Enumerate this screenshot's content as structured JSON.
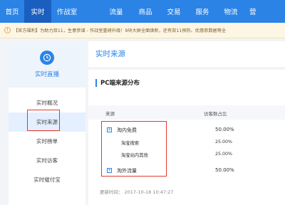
{
  "nav": {
    "items": [
      {
        "label": "首页",
        "active": false
      },
      {
        "label": "实时",
        "active": true
      },
      {
        "label": "作战室",
        "active": false
      },
      {
        "label": "流量",
        "active": false
      },
      {
        "label": "商品",
        "active": false
      },
      {
        "label": "交易",
        "active": false
      },
      {
        "label": "服务",
        "active": false
      },
      {
        "label": "物流",
        "active": false
      },
      {
        "label": "营",
        "active": false
      }
    ]
  },
  "notice": {
    "icon": "exclamation-icon",
    "text": "【官方福利】为助力双11，生意参谋 - 作战室重磅升级！9块大屏全面焕新，还有双11预热、优惠券数据等全"
  },
  "sidebar": {
    "title": "实时直播",
    "icon": "clock-icon",
    "items": [
      {
        "label": "实时概况",
        "active": false
      },
      {
        "label": "实时来源",
        "active": true
      },
      {
        "label": "实时榜单",
        "active": false
      },
      {
        "label": "实时访客",
        "active": false
      },
      {
        "label": "实时催付宝",
        "active": false
      }
    ]
  },
  "main": {
    "title": "实时来源",
    "section_title": "PC端来源分布",
    "columns": {
      "source": "来源",
      "share": "访客数占比"
    },
    "rows": [
      {
        "name": "淘内免费",
        "value": "50.00%",
        "expandable": true
      },
      {
        "name": "淘宝搜索",
        "value": "25.00%",
        "expandable": false
      },
      {
        "name": "淘宝站内其他",
        "value": "25.00%",
        "expandable": false
      },
      {
        "name": "淘外流量",
        "value": "50.00%",
        "expandable": true
      }
    ],
    "update_label": "更新时间：",
    "update_time": "2017-10-18 10:47:27"
  },
  "colors": {
    "accent": "#2b83e6",
    "highlight": "#e23b2e"
  }
}
